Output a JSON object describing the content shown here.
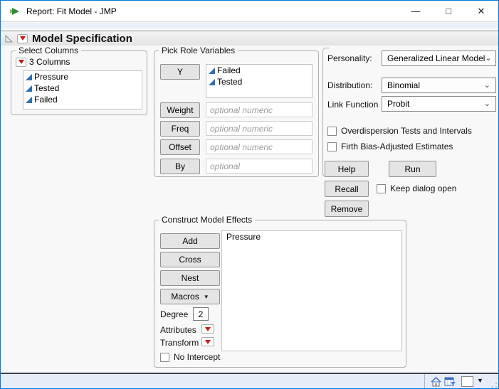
{
  "window": {
    "title": "Report: Fit Model - JMP",
    "minimize_glyph": "—",
    "maximize_glyph": "□",
    "close_glyph": "✕"
  },
  "header": {
    "title": "Model Specification"
  },
  "select_columns": {
    "legend": "Select Columns",
    "count_label": "3 Columns",
    "columns": [
      "Pressure",
      "Tested",
      "Failed"
    ]
  },
  "pick_roles": {
    "legend": "Pick Role Variables",
    "y_button": "Y",
    "y_items": [
      "Failed",
      "Tested"
    ],
    "weight_button": "Weight",
    "weight_placeholder": "optional numeric",
    "freq_button": "Freq",
    "freq_placeholder": "optional numeric",
    "offset_button": "Offset",
    "offset_placeholder": "optional numeric",
    "by_button": "By",
    "by_placeholder": "optional"
  },
  "options": {
    "personality_label": "Personality:",
    "personality_value": "Generalized Linear Model",
    "distribution_label": "Distribution:",
    "distribution_value": "Binomial",
    "link_label": "Link Function",
    "link_value": "Probit",
    "overdispersion_label": "Overdispersion Tests and Intervals",
    "firth_label": "Firth Bias-Adjusted Estimates"
  },
  "actions": {
    "help": "Help",
    "run": "Run",
    "recall": "Recall",
    "remove": "Remove",
    "keep_dialog_open": "Keep dialog open"
  },
  "effects": {
    "legend": "Construct Model Effects",
    "add": "Add",
    "cross": "Cross",
    "nest": "Nest",
    "macros": "Macros",
    "degree_label": "Degree",
    "degree_value": "2",
    "attributes_label": "Attributes",
    "transform_label": "Transform",
    "no_intercept_label": "No Intercept",
    "items": [
      "Pressure"
    ]
  },
  "icons": {
    "chevron": "⌄",
    "macros_triangle": "▼",
    "status_triangle": "▼"
  },
  "colors": {
    "accent": "#0078d7",
    "red_triangle": "#d01616",
    "column_icon_blue": "#2f6fae",
    "status_bar": "#e6edf8"
  }
}
